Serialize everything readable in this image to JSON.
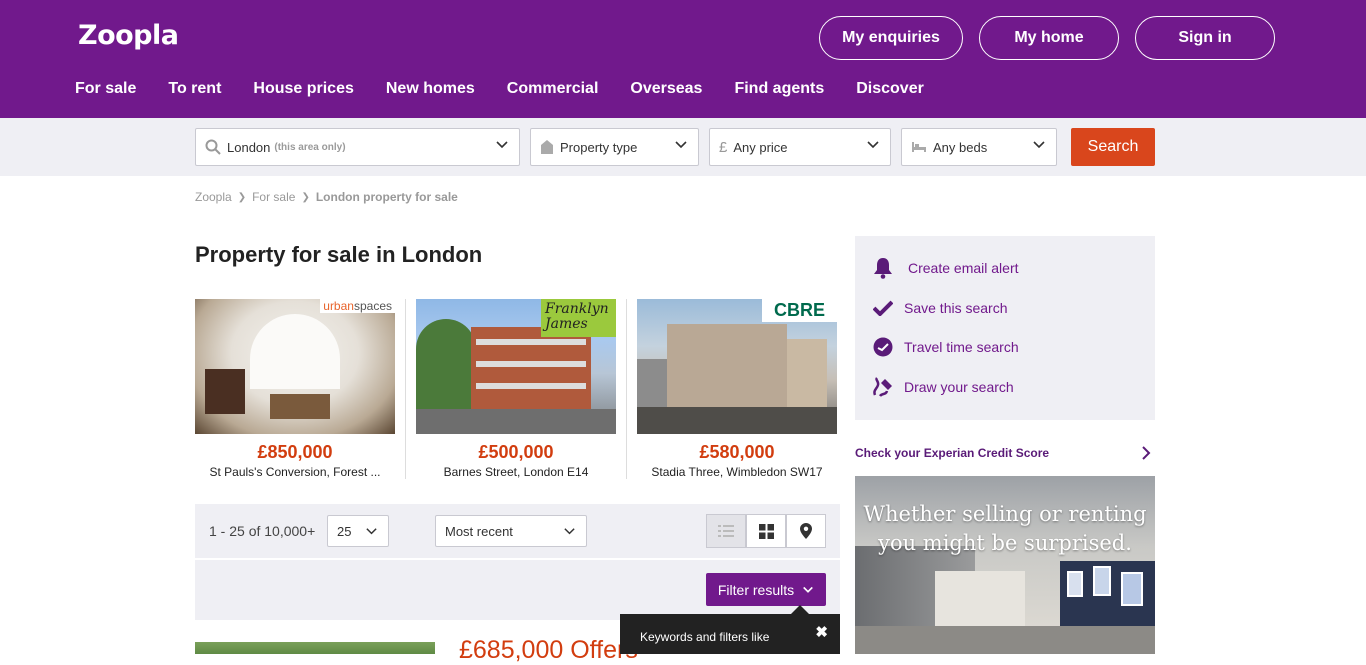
{
  "header": {
    "logo": "Zoopla",
    "buttons": [
      "My enquiries",
      "My home",
      "Sign in"
    ],
    "nav": [
      "For sale",
      "To rent",
      "House prices",
      "New homes",
      "Commercial",
      "Overseas",
      "Find agents",
      "Discover"
    ]
  },
  "search": {
    "location": "London",
    "location_hint": "(this area only)",
    "property_type": "Property type",
    "price": "Any price",
    "beds": "Any beds",
    "button": "Search"
  },
  "breadcrumb": [
    "Zoopla",
    "For sale",
    "London property for sale"
  ],
  "page_title": "Property for sale in London",
  "featured": [
    {
      "price": "£850,000",
      "address": "St Pauls's Conversion, Forest ...",
      "agent": "urbanspaces"
    },
    {
      "price": "£500,000",
      "address": "Barnes Street, London E14",
      "agent": "Franklyn James"
    },
    {
      "price": "£580,000",
      "address": "Stadia Three, Wimbledon SW17",
      "agent": "CBRE"
    }
  ],
  "results": {
    "count": "1 - 25 of 10,000+",
    "per_page": "25",
    "sort": "Most recent",
    "filter_button": "Filter results"
  },
  "listing": {
    "price": "£685,000 Offers"
  },
  "tooltip": {
    "text": "Keywords and filters like"
  },
  "sidebar": {
    "items": [
      "Create email alert",
      "Save this search",
      "Travel time search",
      "Draw your search"
    ],
    "credit": "Check your Experian Credit Score",
    "ad_text": "Whether selling or renting you might be surprised."
  }
}
